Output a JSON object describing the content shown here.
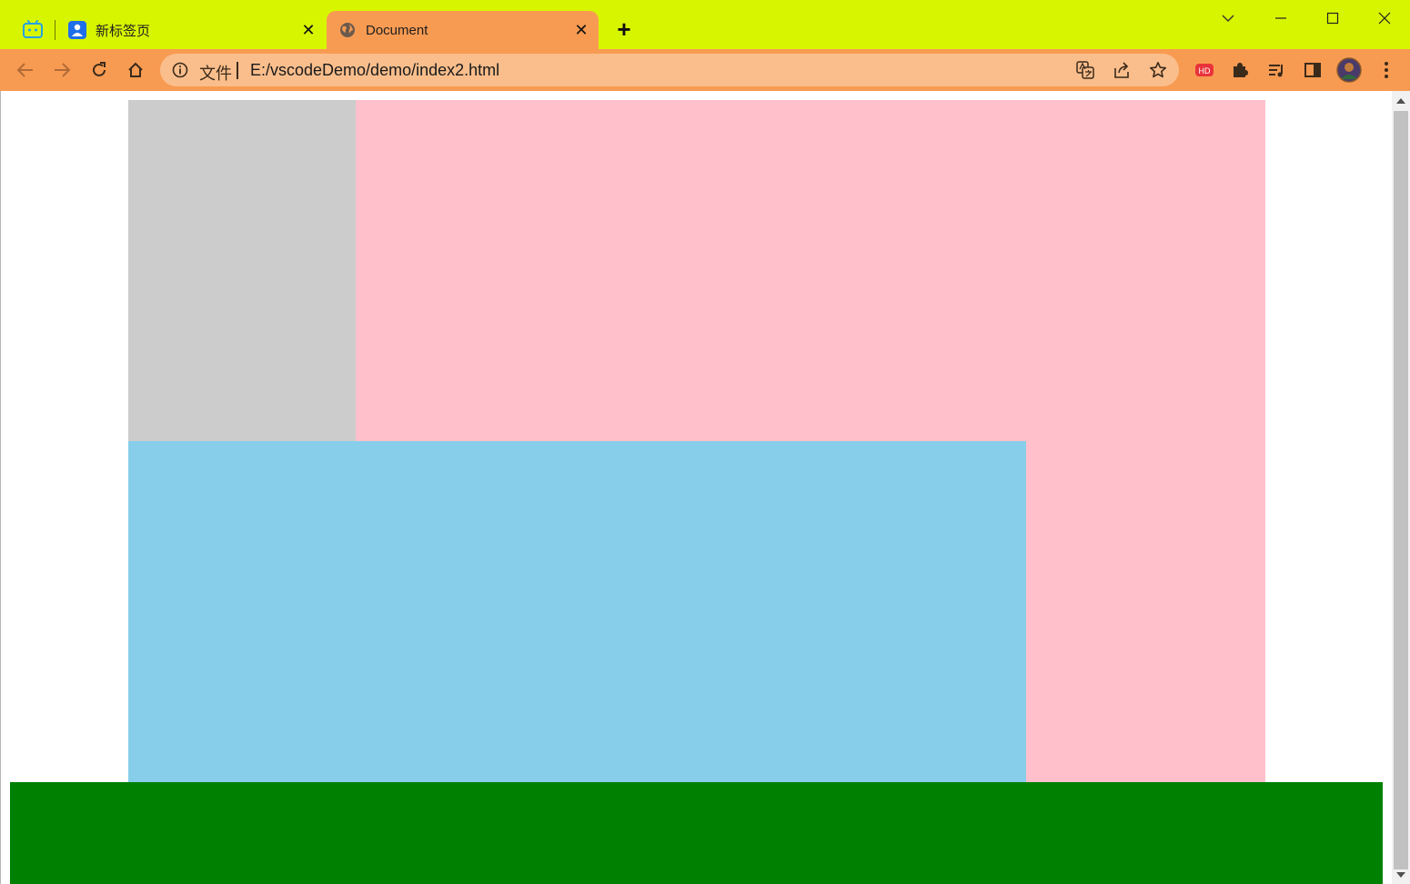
{
  "browser": {
    "tabs": [
      {
        "title": "新标签页",
        "close_glyph": "✕",
        "favicon": "profile-icon"
      },
      {
        "title": "Document",
        "close_glyph": "✕",
        "favicon": "globe-icon",
        "active": true
      }
    ],
    "pinned_tab_icon": "bilibili-tv-icon",
    "new_tab_glyph": "+",
    "omnibox": {
      "scheme_label": "文件",
      "url": "E:/vscodeDemo/demo/index2.html"
    },
    "extension_badge": "HD",
    "colors": {
      "tabstrip": "#d8f500",
      "toolbar": "#f89b52",
      "omnibox": "#fabe8c"
    }
  },
  "page": {
    "blocks": [
      {
        "name": "gray-box",
        "color": "#cccccc"
      },
      {
        "name": "pink-box",
        "color": "#ffc0cb"
      },
      {
        "name": "blue-box",
        "color": "#87ceeb"
      },
      {
        "name": "green-box",
        "color": "#008000"
      }
    ]
  }
}
